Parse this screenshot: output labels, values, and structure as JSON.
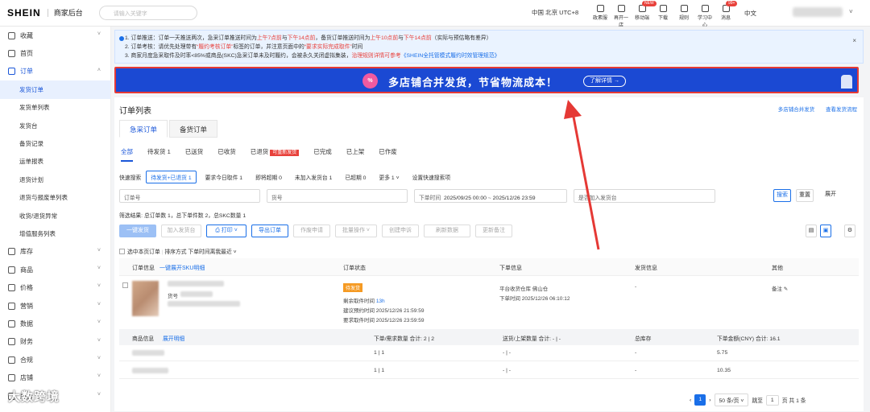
{
  "topbar": {
    "logo": "SHEIN",
    "subtitle": "商家后台",
    "search_placeholder": "请输入关键字",
    "timezone": "中国 北京 UTC+8",
    "tools": [
      {
        "label": "政素服",
        "icon": "globe-icon"
      },
      {
        "label": "再开一店",
        "icon": "store-icon"
      },
      {
        "label": "移动端",
        "icon": "mobile-icon",
        "badge": "NEW"
      },
      {
        "label": "下载",
        "icon": "download-icon"
      },
      {
        "label": "规则",
        "icon": "rules-icon"
      },
      {
        "label": "学习中心",
        "icon": "learn-icon"
      },
      {
        "label": "消息",
        "icon": "bell-icon",
        "badge": "99+"
      }
    ],
    "language": "中文"
  },
  "sidebar": {
    "items": [
      {
        "label": "收藏",
        "icon": "star-icon",
        "chevron": "˅"
      },
      {
        "label": "首页",
        "icon": "home-icon"
      },
      {
        "label": "订单",
        "icon": "order-icon",
        "chevron": "˄",
        "open": true
      },
      {
        "label": "发货订单",
        "sub": true,
        "active": true
      },
      {
        "label": "发货单列表",
        "sub": true
      },
      {
        "label": "发货台",
        "sub": true
      },
      {
        "label": "备货记录",
        "sub": true
      },
      {
        "label": "运单报表",
        "sub": true
      },
      {
        "label": "退货计划",
        "sub": true
      },
      {
        "label": "退货与报废单列表",
        "sub": true
      },
      {
        "label": "收货/退货异常",
        "sub": true
      },
      {
        "label": "增值服务列表",
        "sub": true
      },
      {
        "label": "库存",
        "icon": "box-icon",
        "chevron": "˅"
      },
      {
        "label": "商品",
        "icon": "product-icon",
        "chevron": "˅"
      },
      {
        "label": "价格",
        "icon": "price-icon",
        "chevron": "˅"
      },
      {
        "label": "营销",
        "icon": "marketing-icon",
        "chevron": "˅"
      },
      {
        "label": "数据",
        "icon": "data-icon",
        "chevron": "˅"
      },
      {
        "label": "财务",
        "icon": "finance-icon",
        "chevron": "˅"
      },
      {
        "label": "合规",
        "icon": "compliance-icon",
        "chevron": "˅"
      },
      {
        "label": "店铺",
        "icon": "shop-icon",
        "chevron": "˅"
      },
      {
        "label": "服务",
        "icon": "service-icon",
        "chevron": "˅"
      }
    ],
    "watermark": "大数跨境"
  },
  "notice": {
    "l1a": "1. 订单推送：订单一天推送两次，急采订单推送时间为",
    "l1b": "上午7点前",
    "l1c": "与",
    "l1d": "下午14点前",
    "l1e": "，备货订单推送时间为",
    "l1f": "上午10点前",
    "l1g": "与",
    "l1h": "下午14点前",
    "l1i": "（实际与预估略有差异）",
    "l2a": "2. 订单考核：请优先处理带有",
    "l2b": "“履约考核订单”",
    "l2c": "标签的订单，并注意页面中的",
    "l2d": "“要求实际完成取件”",
    "l2e": "时间",
    "l3a": "3. 商家月度急采取件及时率<85%或商品(SKC)急采订单未及时履约，会被永久关闭虚拟集装，",
    "l3b": "治理规则详情可参考",
    "l3c": "《SHEIN全托管模式履约时效管理规范》",
    "close": "×"
  },
  "banner": {
    "icon": "%",
    "text": "多店铺合并发货，节省物流成本！",
    "button": "了解详情 →"
  },
  "page": {
    "title": "订单列表",
    "links": [
      "多店铺合并发货",
      "查看发货流程"
    ],
    "big_tabs": [
      "急采订单",
      "备货订单"
    ],
    "status_tabs": [
      "全部",
      "待发货 1",
      "已送货",
      "已收货",
      "已退货",
      "已完成",
      "已上架",
      "已作废"
    ],
    "status_tag": "可重新发货",
    "quick_label": "快速搜索",
    "quick": [
      "待发货+已退货 1",
      "要求今日取件 1",
      "即将超期 0",
      "未加入发货台 1",
      "已超期 0"
    ],
    "more": "更多 1 ˅",
    "quick_setting": "设置快速搜索项",
    "filter_order": "订单号",
    "filter_sku": "货号",
    "filter_time_label": "下单时间",
    "filter_time_from": "2025/09/25 00:00",
    "filter_time_sep": "~",
    "filter_time_to": "2025/12/26 23:59",
    "filter_join": "是否加入发货台",
    "search": "搜索",
    "reset": "重置",
    "expand": "展开",
    "summary": "筛选结果: 总订单数 1，总下单件数 2，总SKC数量 1",
    "actions": [
      "一键发货",
      "加入发货台",
      "⎙ 打印 ˅",
      "导出订单",
      "作废申请",
      "批量操作 ˅",
      "创建申诉",
      "刷新数据",
      "更新备注"
    ],
    "select_page": "选中本页订单",
    "sort": "排序方式  下单时间离我最近 ˅",
    "columns": [
      "订单信息",
      "一键展开SKU明细",
      "订单状态",
      "下单信息",
      "发货信息",
      "其他"
    ],
    "order": {
      "status": "待发货",
      "remain_label": "剩余取件时间",
      "remain": "13h",
      "suggest": "建议预约时间 2025/12/26 21:59:59",
      "required": "要求取件时间 2025/12/26 23:59:59",
      "warehouse": "平台收货仓库 佛山仓",
      "order_time": "下单时间 2025/12/26 06:10:12",
      "ship": "-",
      "note": "备注 ✎",
      "sku_prefix": "货号"
    },
    "item_columns": [
      "商品信息",
      "展开明细",
      "下单/需求数量 合计: 2 | 2",
      "送货/上架数量 合计: - | -",
      "总库存",
      "下单金额(CNY) 合计: 16.1"
    ],
    "items": [
      {
        "qty": "1 | 1",
        "ship": "- | -",
        "stock": "-",
        "amount": "5.75"
      },
      {
        "qty": "1 | 1",
        "ship": "- | -",
        "stock": "-",
        "amount": "10.35"
      }
    ],
    "pager": {
      "current": "1",
      "size": "50 条/页 ˅",
      "goto": "跳至",
      "goto_val": "1",
      "total": "页  共 1 条"
    }
  },
  "annotation_color": "#e53935",
  "accent": "#1a6fe8"
}
